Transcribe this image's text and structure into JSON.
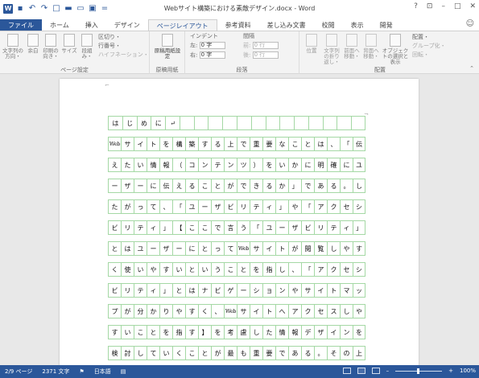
{
  "window": {
    "title": "Webサイト構築における素敵デザイン.docx - Word",
    "controls": {
      "help": "?",
      "ribbon_opts": "⊡",
      "minimize": "–",
      "maximize": "□",
      "close": "✕"
    },
    "signin_icon": "person-icon"
  },
  "qat": {
    "app_logo": "W",
    "save": "▪",
    "undo": "↶",
    "redo": "↷",
    "new": "□",
    "open": "▬",
    "print": "▭",
    "preview": "▣",
    "more": "="
  },
  "tabs": [
    "ファイル",
    "ホーム",
    "挿入",
    "デザイン",
    "ページレイアウト",
    "参考資料",
    "差し込み文書",
    "校閲",
    "表示",
    "開発"
  ],
  "active_tab": "ページレイアウト",
  "ribbon": {
    "page_setup": {
      "label": "ページ設定",
      "buttons": [
        "文字列の方向・",
        "余白",
        "印刷の向き・",
        "サイズ",
        "段組み・"
      ],
      "small": [
        "区切り・",
        "行番号・",
        "ハイフネーション・"
      ]
    },
    "manuscript": {
      "label": "原稿用紙",
      "button": "原稿用紙設定"
    },
    "paragraph": {
      "label": "段落",
      "indent_title": "インデント",
      "spacing_title": "間隔",
      "left_label": "左:",
      "left_value": "0 字",
      "right_label": "右:",
      "right_value": "0 字",
      "before_label": "前:",
      "before_value": "0 行",
      "after_label": "後:",
      "after_value": "0 行"
    },
    "arrange": {
      "label": "配置",
      "buttons": [
        "位置",
        "文字列の折り返し・",
        "前面へ移動・",
        "背面へ移動・",
        "オブジェクトの選択と表示"
      ],
      "small": [
        "配置・",
        "グループ化・",
        "回転・"
      ]
    }
  },
  "document": {
    "lines": [
      [
        "は",
        "じ",
        "め",
        "に",
        "↵",
        "",
        "",
        "",
        "",
        "",
        "",
        "",
        "",
        "",
        "",
        "",
        "",
        ""
      ],
      [
        "Web",
        "サ",
        "イ",
        "ト",
        "を",
        "構",
        "築",
        "す",
        "る",
        "上",
        "で",
        "重",
        "要",
        "な",
        "こ",
        "と",
        "は",
        "、",
        "「",
        "伝"
      ],
      [
        "え",
        "た",
        "い",
        "情",
        "報",
        "（",
        "コ",
        "ン",
        "テ",
        "ン",
        "ツ",
        "）",
        "を",
        "い",
        "か",
        "に",
        "明",
        "確",
        "に",
        "ユ"
      ],
      [
        "ー",
        "ザ",
        "ー",
        "に",
        "伝",
        "え",
        "る",
        "こ",
        "と",
        "が",
        "で",
        "き",
        "る",
        "か",
        "」",
        "で",
        "あ",
        "る",
        "。",
        "し"
      ],
      [
        "た",
        "が",
        "っ",
        "て",
        "、",
        "「",
        "ユ",
        "ー",
        "ザ",
        "ビ",
        "リ",
        "テ",
        "ィ",
        "」",
        "や",
        "「",
        "ア",
        "ク",
        "セ",
        "シ"
      ],
      [
        "ビ",
        "リ",
        "テ",
        "ィ",
        "」",
        "【",
        "こ",
        "こ",
        "で",
        "言",
        "う",
        "「",
        "ユ",
        "ー",
        "ザ",
        "ビ",
        "リ",
        "テ",
        "ィ",
        "」"
      ],
      [
        "と",
        "は",
        "ユ",
        "ー",
        "ザ",
        "ー",
        "に",
        "と",
        "っ",
        "て",
        "Web",
        "サ",
        "イ",
        "ト",
        "が",
        "閲",
        "覧",
        "し",
        "や",
        "す"
      ],
      [
        "く",
        "使",
        "い",
        "や",
        "す",
        "い",
        "と",
        "い",
        "う",
        "こ",
        "と",
        "を",
        "指",
        "し",
        "、",
        "「",
        "ア",
        "ク",
        "セ",
        "シ"
      ],
      [
        "ビ",
        "リ",
        "テ",
        "ィ",
        "」",
        "と",
        "は",
        "ナ",
        "ビ",
        "ゲ",
        "ー",
        "シ",
        "ョ",
        "ン",
        "や",
        "サ",
        "イ",
        "ト",
        "マ",
        "ッ"
      ],
      [
        "プ",
        "が",
        "分",
        "か",
        "り",
        "や",
        "す",
        "く",
        "、",
        "Web",
        "サ",
        "イ",
        "ト",
        "へ",
        "ア",
        "ク",
        "セ",
        "ス",
        "し",
        "や"
      ],
      [
        "す",
        "い",
        "こ",
        "と",
        "を",
        "指",
        "す",
        "】",
        "を",
        "考",
        "慮",
        "し",
        "た",
        "情",
        "報",
        "デ",
        "ザ",
        "イ",
        "ン",
        "を"
      ],
      [
        "検",
        "討",
        "し",
        "て",
        "い",
        "く",
        "こ",
        "と",
        "が",
        "最",
        "も",
        "重",
        "要",
        "で",
        "あ",
        "る",
        "。",
        "そ",
        "の",
        "上"
      ]
    ]
  },
  "status": {
    "page": "2/9 ページ",
    "words": "2371 文字",
    "proof_icon": "proofing-icon",
    "language": "日本語",
    "macro_icon": "macro-icon",
    "zoom": "100%",
    "zoom_minus": "–",
    "zoom_plus": "+"
  }
}
